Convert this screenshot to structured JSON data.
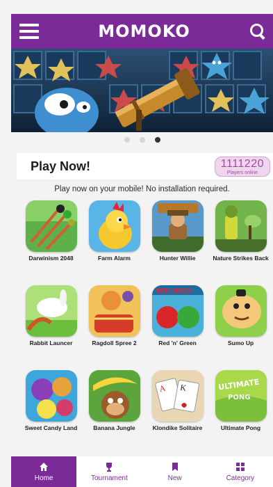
{
  "header": {
    "menu_icon": "menu-icon",
    "logo": "MOMOKO",
    "search_icon": "search-icon",
    "color": "#7b2b97"
  },
  "banner": {
    "slides": 3,
    "active_slide": 3
  },
  "play_now": {
    "title": "Play Now!",
    "player_count": "1111220",
    "player_count_label": "Players online",
    "subtitle": "Play now on your mobile! No installation required."
  },
  "games": [
    {
      "name": "Darwinism 2048"
    },
    {
      "name": "Farm Alarm"
    },
    {
      "name": "Hunter Willie"
    },
    {
      "name": "Nature Strikes Back"
    },
    {
      "name": "Rabbit Launcer"
    },
    {
      "name": "Ragdoll Spree 2"
    },
    {
      "name": "Red 'n' Green"
    },
    {
      "name": "Sumo Up"
    },
    {
      "name": "Sweet Candy Land"
    },
    {
      "name": "Banana Jungle"
    },
    {
      "name": "Klondike Solitaire"
    },
    {
      "name": "Ultimate Pong"
    }
  ],
  "nav": [
    {
      "label": "Home",
      "icon": "home-icon",
      "active": true
    },
    {
      "label": "Tournament",
      "icon": "trophy-icon",
      "active": false
    },
    {
      "label": "New",
      "icon": "bookmark-icon",
      "active": false
    },
    {
      "label": "Category",
      "icon": "grid-icon",
      "active": false
    }
  ]
}
